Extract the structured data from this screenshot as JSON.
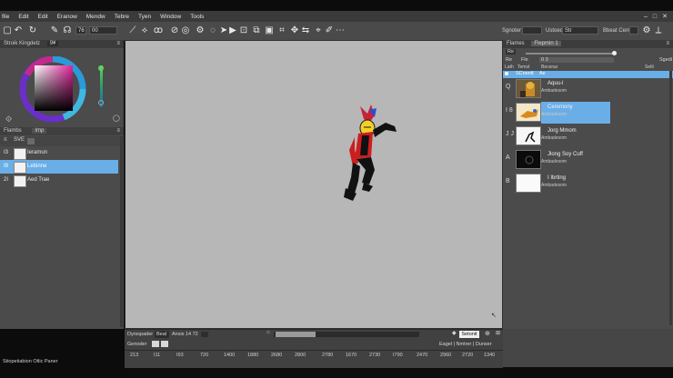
{
  "menu": [
    "file",
    "Edit",
    "Edit",
    "Eranow",
    "Mendw",
    "Tebre",
    "Tyen",
    "Window",
    "Tools"
  ],
  "window_controls": [
    "–",
    "□",
    "✕"
  ],
  "toolbar": {
    "zoom_value": "00",
    "brush_value": "76",
    "right_label_1": "Sgnoter",
    "right_label_2": "Ustoed",
    "right_field_2": "Str",
    "right_label_3": "Bbeat Cented",
    "icons": [
      "new-icon",
      "undo-icon",
      "redo-icon",
      "pen-icon",
      "headphones-icon",
      "brush-size-icon",
      "pencil-icon",
      "transform-icon",
      "lasso-icon",
      "link-icon",
      "eye-icon",
      "gear-icon",
      "fill-icon",
      "palette-icon",
      "send-icon",
      "play-icon",
      "magic-wand-icon",
      "rect-select-icon",
      "layers-icon",
      "frame-icon",
      "crop-icon",
      "move-icon",
      "flip-icon",
      "eyedropper-icon",
      "brush-icon",
      "more-icon"
    ]
  },
  "color_panel": {
    "title": "Stroik Kingdelz",
    "tag": "9¥",
    "accent": "#5fd35a"
  },
  "frames_panel": {
    "tabs": [
      "Flambs",
      "Imp"
    ],
    "filter_value": "SVE",
    "rows": [
      {
        "idx": "I3",
        "label": "Ieramun"
      },
      {
        "idx": "I9",
        "label": "Lebinne"
      },
      {
        "idx": "2I",
        "label": "Aed Trae"
      }
    ]
  },
  "layers_panel": {
    "tabs": [
      "Flames",
      "Flepmin 1"
    ],
    "slider_label_left": "Re",
    "slider_label_mid": "Fle",
    "slider_value": "0 3",
    "slider_right": "Sgedi",
    "col_headers": [
      "Lath",
      "Temst",
      "Beceraz",
      "Setli"
    ],
    "selected_header": "SCnentl",
    "selected_header_right": "Ae",
    "layers": [
      {
        "idx": "Q",
        "name": "Aquu-l",
        "sub": "Ambadesom"
      },
      {
        "idx": "I 8",
        "name": "Ceremony",
        "sub": "Ambadesom"
      },
      {
        "idx": "J J",
        "name": "Jorg Mmom",
        "sub": "Ambadesom"
      },
      {
        "idx": "A",
        "name": "Jlong Soy Cuff",
        "sub": "Ambadesom"
      },
      {
        "idx": "B",
        "name": "I Ibrting",
        "sub": "Ambadesom"
      }
    ]
  },
  "timeline": {
    "label_1": "Dyrsspader",
    "field_1": "Beal",
    "label_2": "Ansis 14 72",
    "button": "Setonit",
    "label_3": "Genoder",
    "right_label": "Eagel | Nmtrer | Dunser",
    "ticks": [
      "213",
      "I11",
      "I93",
      "720",
      "1400",
      "1880",
      "2680",
      "2800",
      "2780",
      "1670",
      "2730",
      "I790",
      "2470",
      "2960",
      "2720",
      "1340"
    ]
  },
  "status_text": "Stiopetiabion Otlic Paner",
  "colors": {
    "selection": "#6aaee7",
    "canvas": "#b7b7b7",
    "panel": "#4b4b4b"
  }
}
